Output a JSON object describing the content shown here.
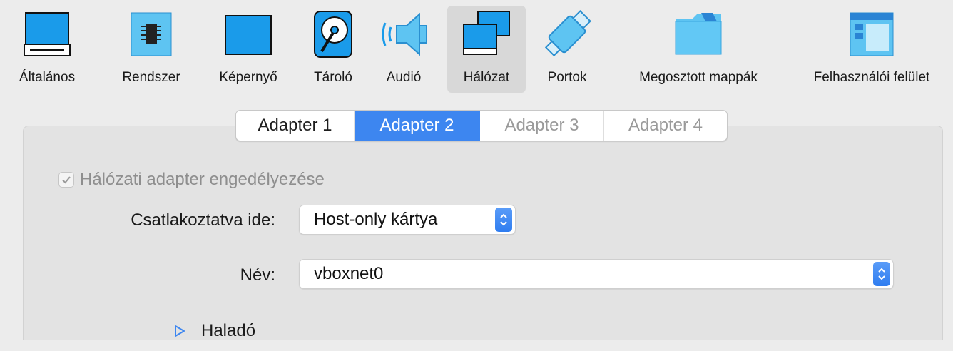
{
  "toolbar": {
    "items": [
      {
        "label": "Általános",
        "icon": "general-icon"
      },
      {
        "label": "Rendszer",
        "icon": "system-chip-icon"
      },
      {
        "label": "Képernyő",
        "icon": "display-icon"
      },
      {
        "label": "Tároló",
        "icon": "storage-disk-icon"
      },
      {
        "label": "Audió",
        "icon": "speaker-icon"
      },
      {
        "label": "Hálózat",
        "icon": "network-icon"
      },
      {
        "label": "Portok",
        "icon": "ports-icon"
      },
      {
        "label": "Megosztott mappák",
        "icon": "shared-folder-icon"
      },
      {
        "label": "Felhasználói felület",
        "icon": "user-interface-icon"
      }
    ],
    "selected": "Hálózat"
  },
  "tabs": [
    {
      "label": "Adapter 1",
      "state": "normal"
    },
    {
      "label": "Adapter 2",
      "state": "active"
    },
    {
      "label": "Adapter 3",
      "state": "disabled"
    },
    {
      "label": "Adapter 4",
      "state": "disabled"
    }
  ],
  "adapter": {
    "enable_label": "Hálózati adapter engedélyezése",
    "enabled": true,
    "attached_label": "Csatlakoztatva ide:",
    "attached_value": "Host-only kártya",
    "name_label": "Név:",
    "name_value": "vboxnet0",
    "advanced_label": "Haladó"
  },
  "colors": {
    "accent": "#3d86f0",
    "icon_blue": "#1a9bea"
  }
}
